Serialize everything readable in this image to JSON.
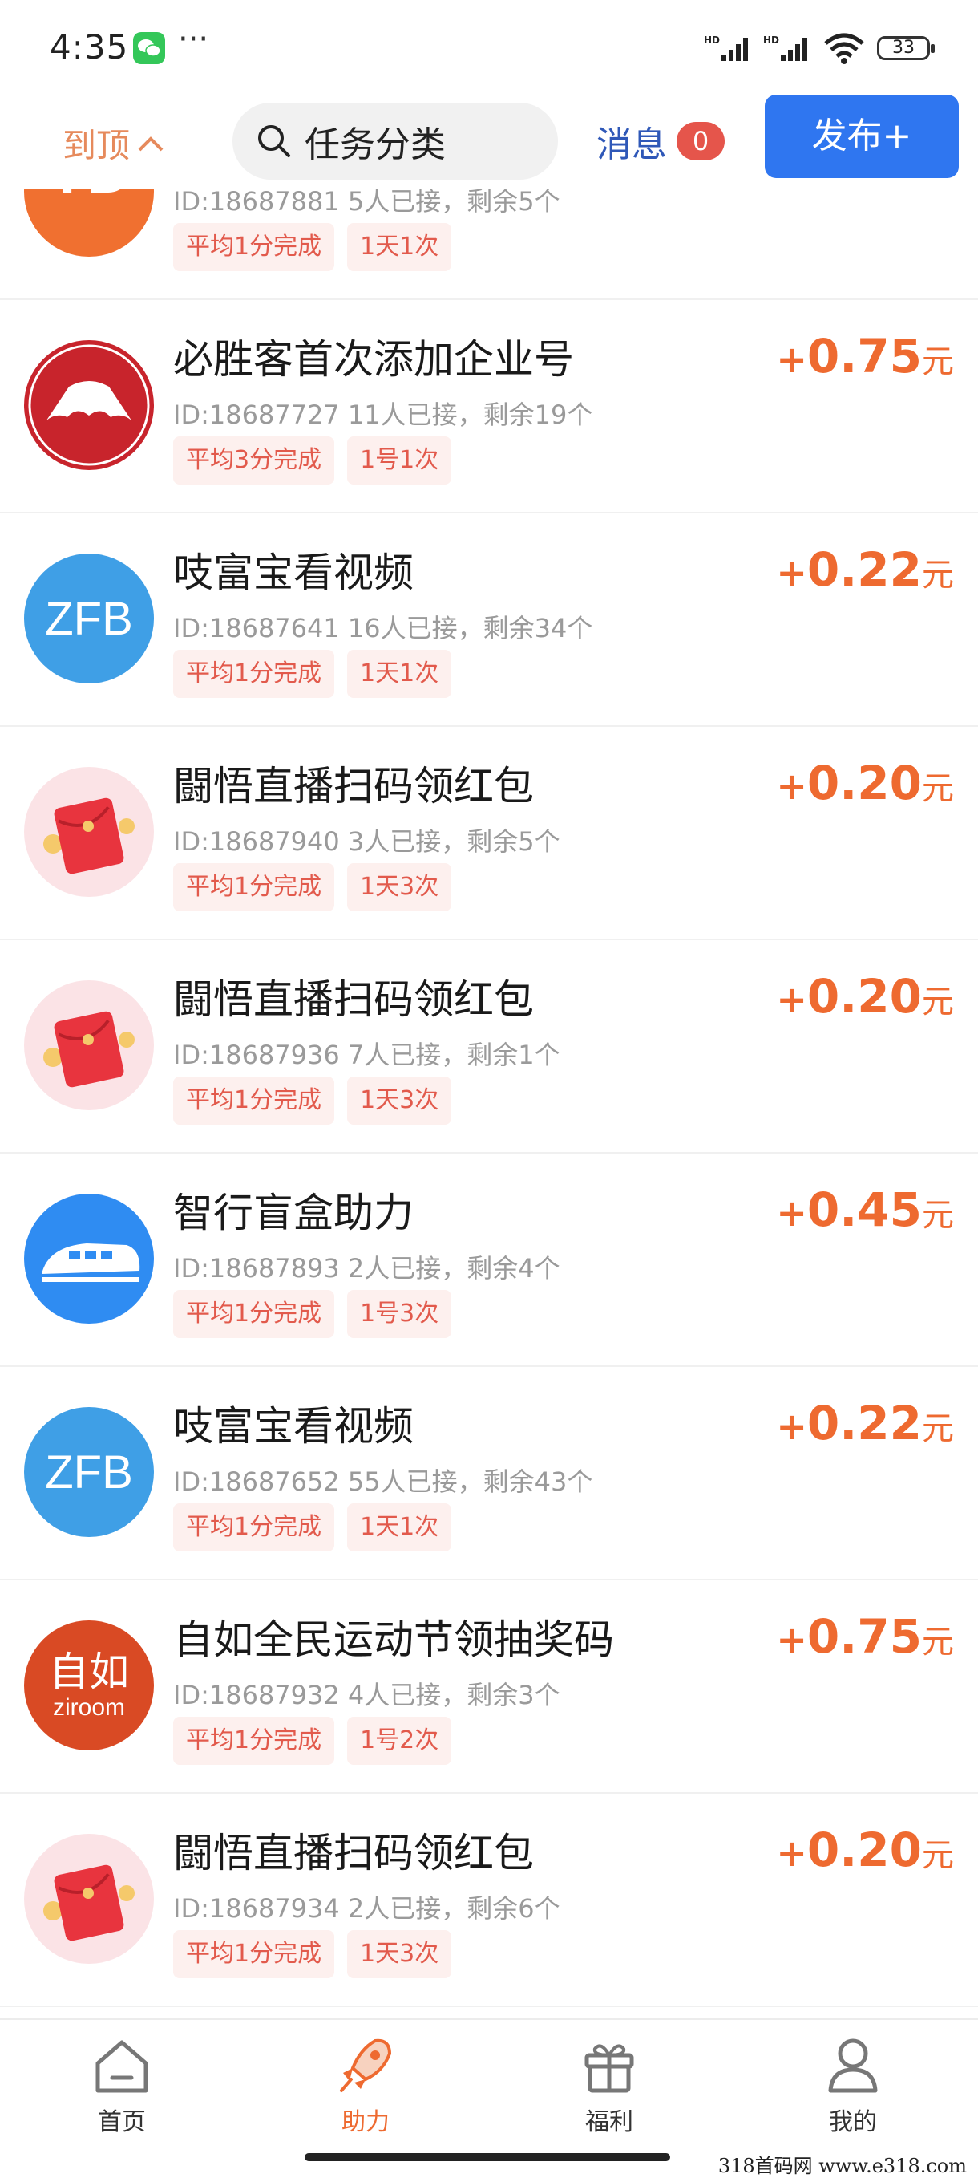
{
  "status_bar": {
    "time": "4:35",
    "dots": "···",
    "battery": "33"
  },
  "top_nav": {
    "to_top": "到顶",
    "search_placeholder": "任务分类",
    "messages_label": "消息",
    "messages_count": "0",
    "publish_label": "发布+"
  },
  "tasks": [
    {
      "icon": "yd-logo",
      "title": "",
      "meta": "ID:18687881   5人已接，剩余5个",
      "tags": [
        "平均1分完成",
        "1天1次"
      ],
      "reward_plus": "",
      "reward_amount": "",
      "reward_unit": ""
    },
    {
      "icon": "pizza-hut-logo",
      "title": "必胜客首次添加企业号",
      "meta": "ID:18687727   11人已接，剩余19个",
      "tags": [
        "平均3分完成",
        "1号1次"
      ],
      "reward_plus": "+",
      "reward_amount": "0.75",
      "reward_unit": "元"
    },
    {
      "icon": "zfb-logo",
      "title": "吱富宝看视频",
      "meta": "ID:18687641   16人已接，剩余34个",
      "tags": [
        "平均1分完成",
        "1天1次"
      ],
      "reward_plus": "+",
      "reward_amount": "0.22",
      "reward_unit": "元"
    },
    {
      "icon": "red-envelope-icon",
      "title": "闘悟直播扫码领红包",
      "meta": "ID:18687940   3人已接，剩余5个",
      "tags": [
        "平均1分完成",
        "1天3次"
      ],
      "reward_plus": "+",
      "reward_amount": "0.20",
      "reward_unit": "元"
    },
    {
      "icon": "red-envelope-icon",
      "title": "闘悟直播扫码领红包",
      "meta": "ID:18687936   7人已接，剩余1个",
      "tags": [
        "平均1分完成",
        "1天3次"
      ],
      "reward_plus": "+",
      "reward_amount": "0.20",
      "reward_unit": "元"
    },
    {
      "icon": "train-logo",
      "title": "智行盲盒助力",
      "meta": "ID:18687893   2人已接，剩余4个",
      "tags": [
        "平均1分完成",
        "1号3次"
      ],
      "reward_plus": "+",
      "reward_amount": "0.45",
      "reward_unit": "元"
    },
    {
      "icon": "zfb-logo",
      "title": "吱富宝看视频",
      "meta": "ID:18687652   55人已接，剩余43个",
      "tags": [
        "平均1分完成",
        "1天1次"
      ],
      "reward_plus": "+",
      "reward_amount": "0.22",
      "reward_unit": "元"
    },
    {
      "icon": "ziroom-logo",
      "title": "自如全民运动节领抽奖码",
      "meta": "ID:18687932   4人已接，剩余3个",
      "tags": [
        "平均1分完成",
        "1号2次"
      ],
      "reward_plus": "+",
      "reward_amount": "0.75",
      "reward_unit": "元"
    },
    {
      "icon": "red-envelope-icon",
      "title": "闘悟直播扫码领红包",
      "meta": "ID:18687934   2人已接，剩余6个",
      "tags": [
        "平均1分完成",
        "1天3次"
      ],
      "reward_plus": "+",
      "reward_amount": "0.20",
      "reward_unit": "元"
    }
  ],
  "logos": {
    "yd": "YD",
    "zfb": "ZFB",
    "ziroom_top": "自如",
    "ziroom_bottom": "ziroom"
  },
  "tab_bar": {
    "tabs": [
      {
        "label": "首页",
        "icon": "home-icon",
        "active": false
      },
      {
        "label": "助力",
        "icon": "rocket-icon",
        "active": true
      },
      {
        "label": "福利",
        "icon": "gift-icon",
        "active": false
      },
      {
        "label": "我的",
        "icon": "user-icon",
        "active": false
      }
    ]
  },
  "watermark": "318首码网  www.e318.com",
  "colors": {
    "accent_orange": "#ee6a30",
    "publish_blue": "#2f76f0",
    "tag_red": "#e25a4c",
    "tag_bg": "#fdf0ee"
  }
}
